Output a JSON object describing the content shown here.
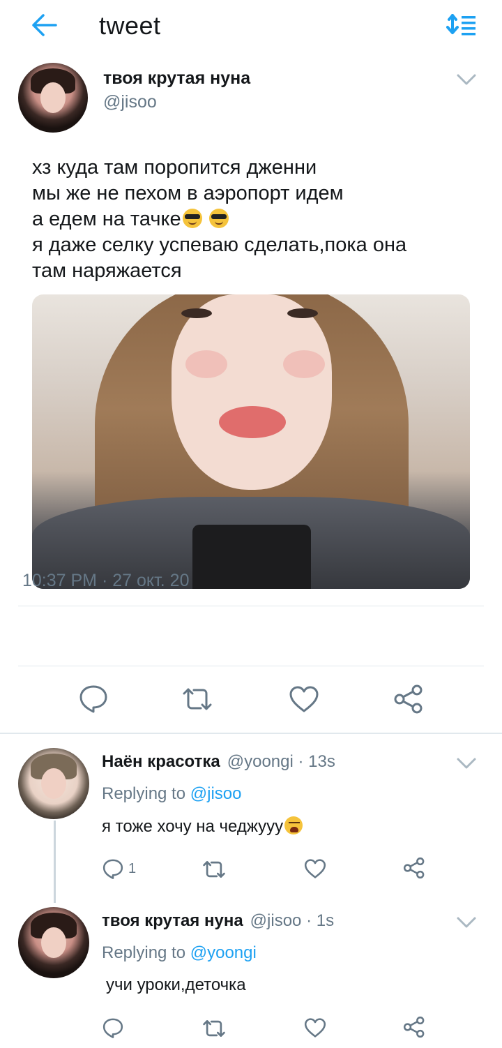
{
  "topbar": {
    "title": "tweet",
    "back_icon": "arrow-left-icon",
    "sort_icon": "sort-order-icon",
    "accent": "#1da1f2"
  },
  "main_tweet": {
    "author_name": "твоя крутая нуна",
    "handle": "@jisoo",
    "text_lines": [
      "хз куда там поропится дженни",
      "мы же не пехом в аэропорт идем",
      "а едем на тачке",
      "я даже селку успеваю сделать,пока она",
      "там наряжается"
    ],
    "timestamp": "10:37 PM · 27 окт. 20",
    "actions": [
      "reply-icon",
      "retweet-icon",
      "like-icon",
      "share-icon"
    ]
  },
  "replies": [
    {
      "author_name": "Наён красотка",
      "handle_time": "@yoongi · 13s",
      "replying_label": "Replying to",
      "replying_to": "@jisoo",
      "text": "я тоже хочу на чеджууу",
      "reply_count": "1"
    },
    {
      "author_name": "твоя крутая нуна",
      "handle_time": "@jisoo · 1s",
      "replying_label": "Replying to",
      "replying_to": "@yoongi",
      "text": "учи уроки,деточка",
      "reply_count": ""
    }
  ],
  "colors": {
    "text": "#14171a",
    "secondary": "#657786",
    "link": "#1da1f2",
    "divider": "#e1e8ed"
  }
}
